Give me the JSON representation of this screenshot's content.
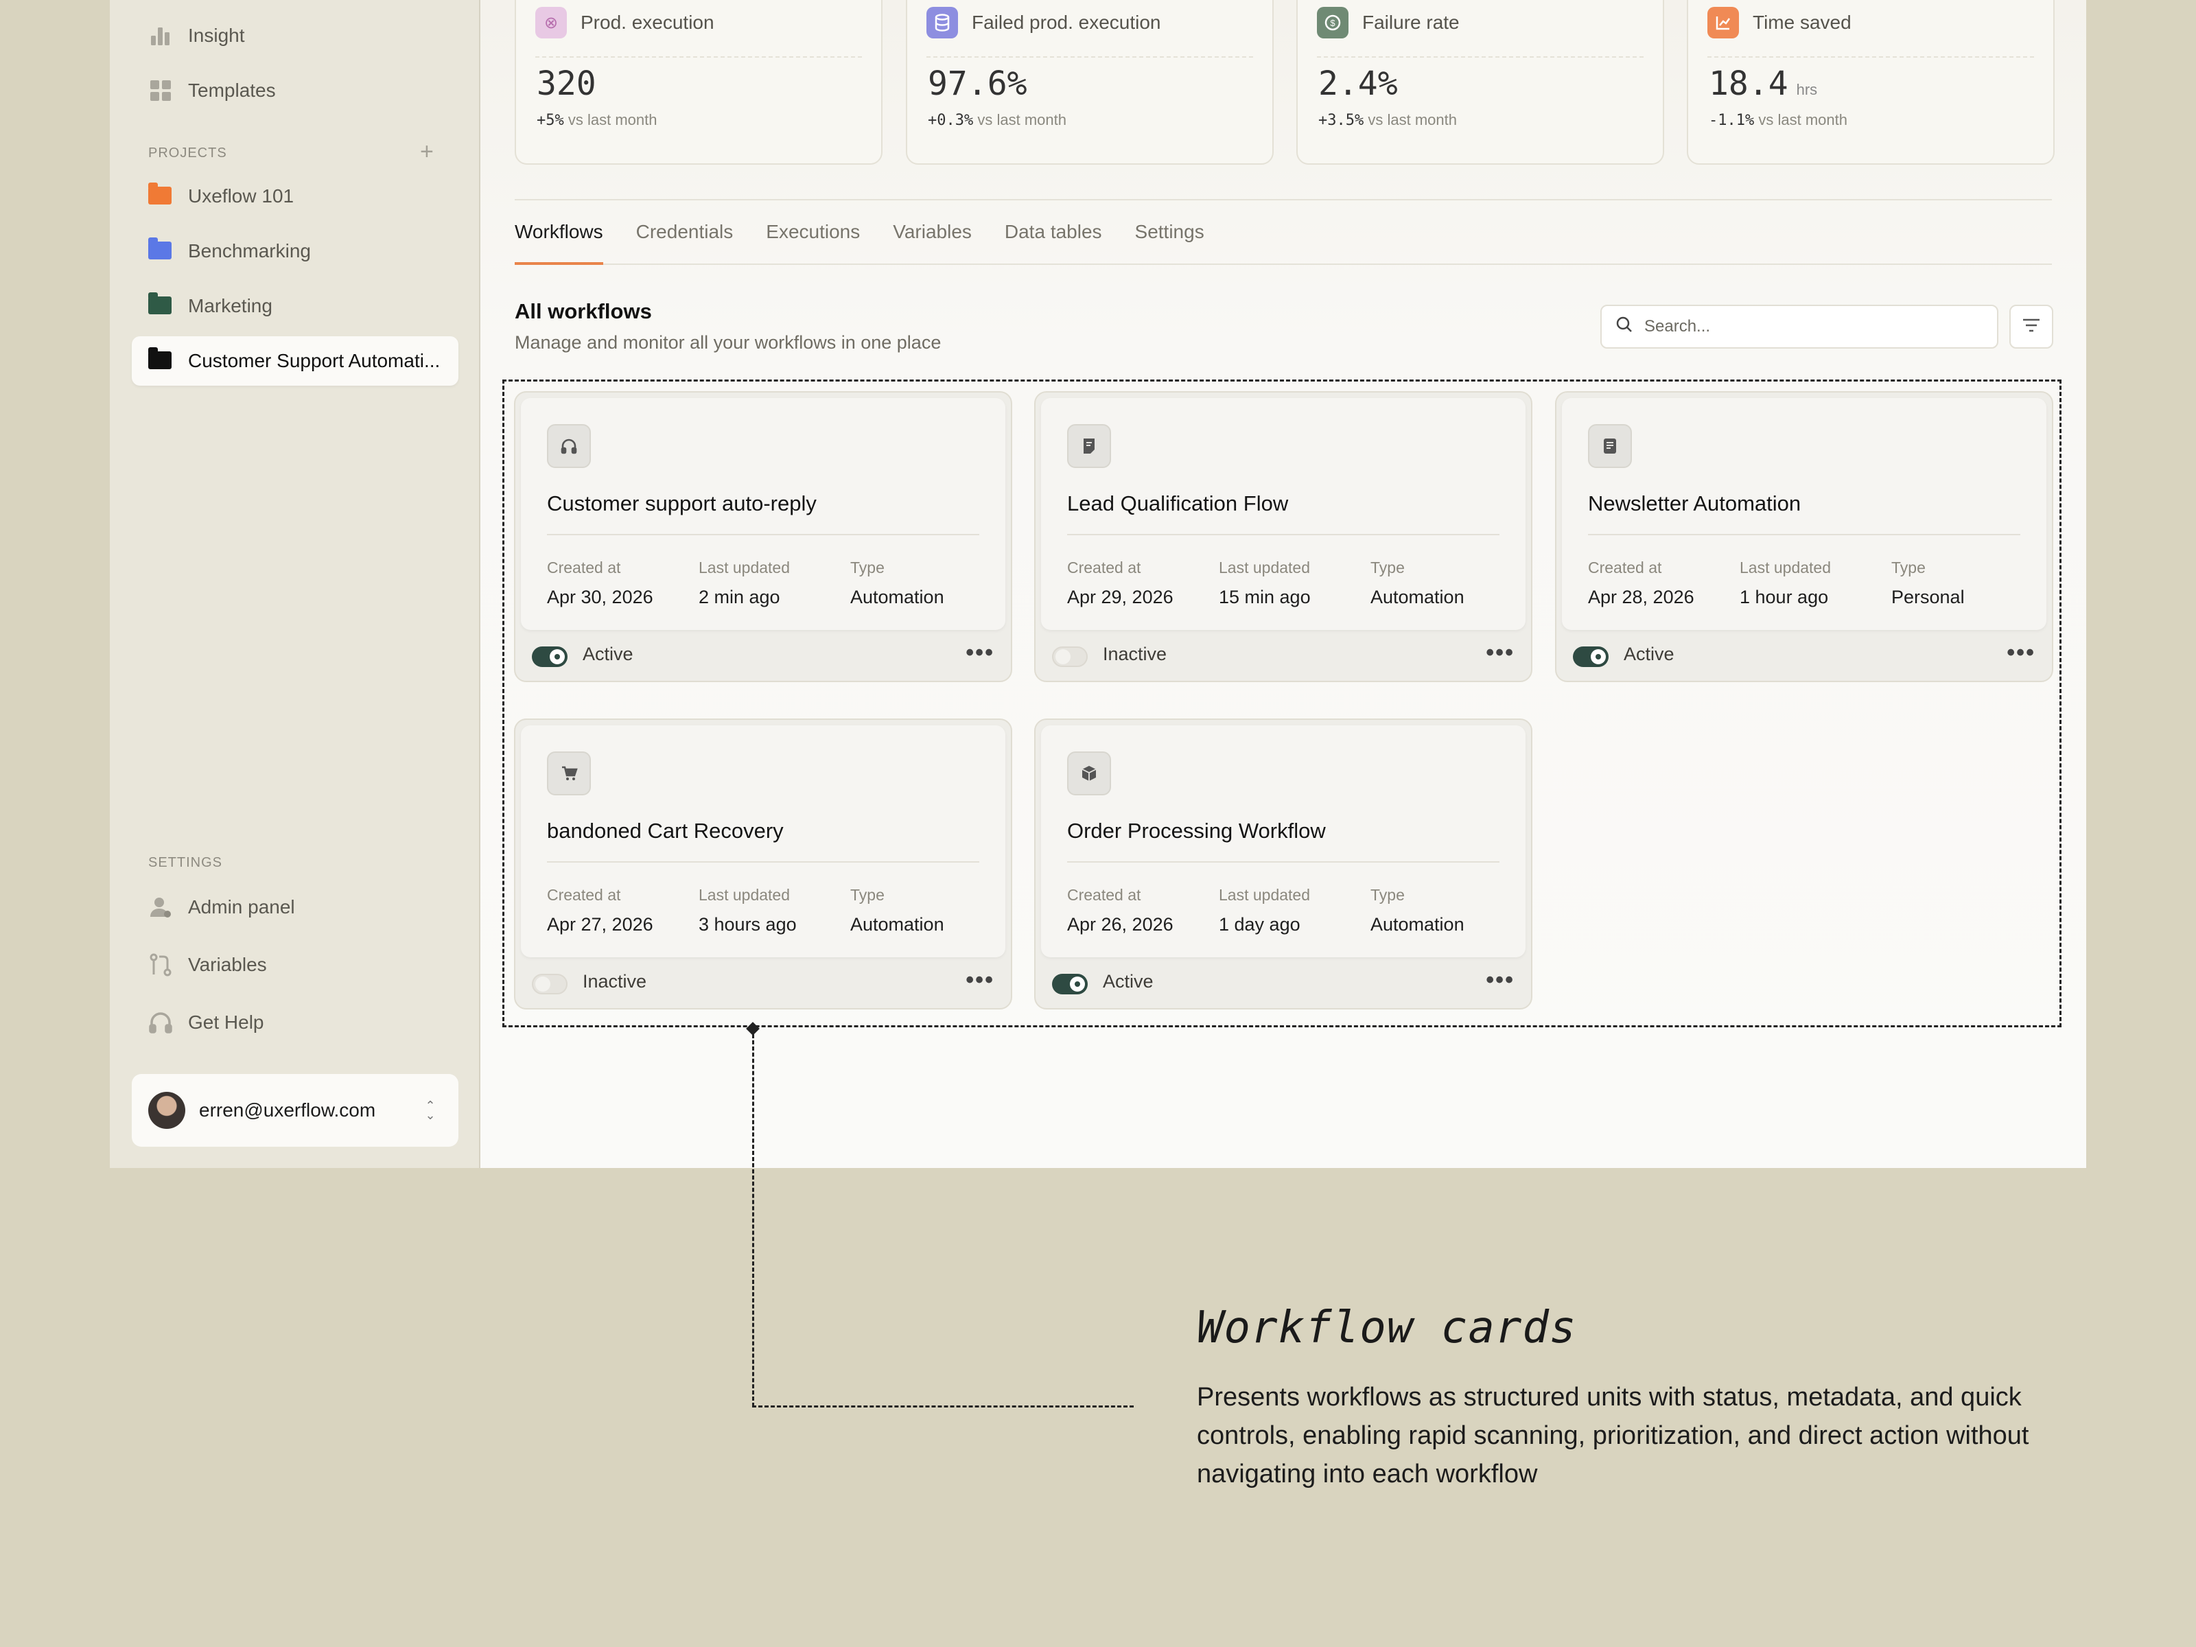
{
  "sidebar": {
    "nav": [
      {
        "label": "Insight",
        "icon": "bar-chart-icon"
      },
      {
        "label": "Templates",
        "icon": "grid-icon"
      }
    ],
    "projects_heading": "PROJECTS",
    "projects": [
      {
        "label": "Uxeflow 101",
        "color": "#f07a35"
      },
      {
        "label": "Benchmarking",
        "color": "#5b78e6"
      },
      {
        "label": "Marketing",
        "color": "#2f5a46"
      },
      {
        "label": "Customer Support Automati...",
        "color": "#111111"
      }
    ],
    "settings_heading": "SETTINGS",
    "settings": [
      {
        "label": "Admin panel",
        "icon": "user-icon"
      },
      {
        "label": "Variables",
        "icon": "branch-icon"
      },
      {
        "label": "Get Help",
        "icon": "headphones-icon"
      }
    ],
    "user_email": "erren@uxerflow.com"
  },
  "stats": [
    {
      "title": "Prod. execution",
      "value": "320",
      "unit": "",
      "delta": "+5%",
      "delta_text": "vs last month",
      "color": "#d9a7d3"
    },
    {
      "title": "Failed prod. execution",
      "value": "97.6%",
      "unit": "",
      "delta": "+0.3%",
      "delta_text": "vs last month",
      "color": "#8d8ee0"
    },
    {
      "title": "Failure rate",
      "value": "2.4%",
      "unit": "",
      "delta": "+3.5%",
      "delta_text": "vs last month",
      "color": "#6f8a74"
    },
    {
      "title": "Time saved",
      "value": "18.4",
      "unit": "hrs",
      "delta": "-1.1%",
      "delta_text": "vs last month",
      "color": "#f08a55"
    }
  ],
  "tabs": [
    "Workflows",
    "Credentials",
    "Executions",
    "Variables",
    "Data tables",
    "Settings"
  ],
  "section": {
    "title": "All workflows",
    "subtitle": "Manage and monitor all your workflows in one place",
    "search_placeholder": "Search..."
  },
  "meta_labels": {
    "created": "Created at",
    "updated": "Last updated",
    "type": "Type"
  },
  "workflows": [
    {
      "title": "Customer support auto-reply",
      "created": "Apr 30, 2026",
      "updated": "2 min ago",
      "type": "Automation",
      "status": "Active",
      "icon": "headphones-icon"
    },
    {
      "title": "Lead Qualification Flow",
      "created": "Apr 29, 2026",
      "updated": "15 min ago",
      "type": "Automation",
      "status": "Inactive",
      "icon": "document-icon"
    },
    {
      "title": "Newsletter Automation",
      "created": "Apr 28, 2026",
      "updated": "1 hour ago",
      "type": "Personal",
      "status": "Active",
      "icon": "newsletter-icon"
    },
    {
      "title": "bandoned Cart Recovery",
      "created": "Apr 27, 2026",
      "updated": "3 hours ago",
      "type": "Automation",
      "status": "Inactive",
      "icon": "cart-icon"
    },
    {
      "title": "Order Processing Workflow",
      "created": "Apr 26, 2026",
      "updated": "1 day ago",
      "type": "Automation",
      "status": "Active",
      "icon": "box-icon"
    }
  ],
  "annotation": {
    "title": "Workflow cards",
    "description": "Presents workflows as structured units with status, metadata, and quick controls, enabling rapid scanning, prioritization, and direct action without navigating into each workflow"
  }
}
